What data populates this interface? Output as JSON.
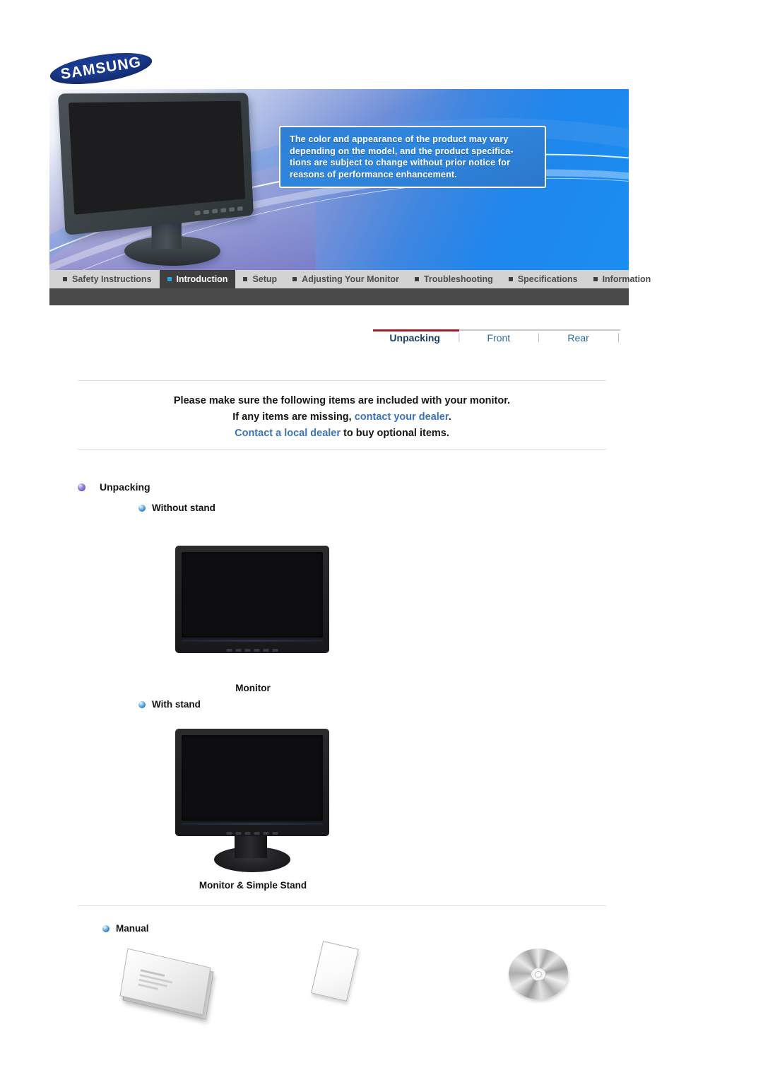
{
  "brand": {
    "name": "SAMSUNG"
  },
  "hero": {
    "notice_lines": [
      "The color and appearance of the product may vary",
      "depending on the model, and the product specifica-",
      "tions are subject to change without prior notice for",
      "reasons of performance enhancement."
    ],
    "accent_blue": "#2f86de"
  },
  "nav": {
    "tabs": [
      {
        "label": "Safety Instructions",
        "active": false
      },
      {
        "label": "Introduction",
        "active": true
      },
      {
        "label": "Setup",
        "active": false
      },
      {
        "label": "Adjusting Your Monitor",
        "active": false
      },
      {
        "label": "Troubleshooting",
        "active": false
      },
      {
        "label": "Specifications",
        "active": false
      },
      {
        "label": "Information",
        "active": false
      }
    ],
    "active_bg": "#3f3f3f",
    "bar_bg": "#d3d3d3"
  },
  "subnav": {
    "items": [
      {
        "label": "Unpacking",
        "current": true
      },
      {
        "label": "Front",
        "current": false
      },
      {
        "label": "Rear",
        "current": false
      }
    ],
    "separator": "⏐",
    "active_underline_color": "#9f2026"
  },
  "intro": {
    "line1": "Please make sure the following items are included with your monitor.",
    "line2_prefix": "If any items are missing, ",
    "line2_link": "contact your dealer",
    "line2_suffix": ".",
    "line3_link": "Contact a local dealer",
    "line3_suffix": " to buy optional items.",
    "link_color": "#3c73b8"
  },
  "sections": {
    "unpacking_label": "Unpacking",
    "without_stand_label": "Without stand",
    "with_stand_label": "With stand",
    "manual_label": "Manual",
    "caption_monitor": "Monitor",
    "caption_monitor_stand": "Monitor & Simple Stand"
  },
  "manual_items": [
    {
      "name": "quick-setup-guide"
    },
    {
      "name": "warranty-card"
    },
    {
      "name": "driver-cd"
    }
  ]
}
